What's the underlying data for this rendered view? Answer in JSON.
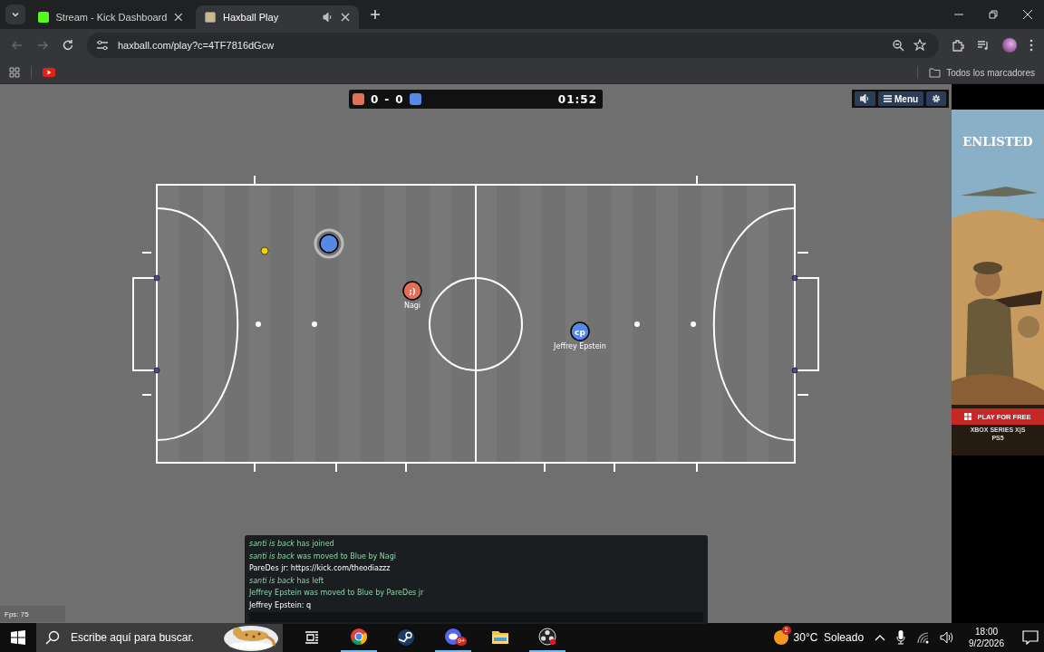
{
  "browser": {
    "tabs": [
      {
        "title": "Stream - Kick Dashboard",
        "selected": false,
        "audio": false
      },
      {
        "title": "Haxball Play",
        "selected": true,
        "audio": true
      }
    ],
    "url": "haxball.com/play?c=4TF7816dGcw",
    "bookmarks_label": "Todos los marcadores"
  },
  "game": {
    "score": {
      "red": "0",
      "separator": "-",
      "blue": "0"
    },
    "time": "01:52",
    "players": [
      {
        "color": "#5689e5",
        "self": true
      },
      {
        "color": "#e56e56",
        "avatar": ";)",
        "name": "Nagi",
        "self": false
      },
      {
        "color": "#5689e5",
        "avatar": "cp",
        "name": "Jeffrey Epstein",
        "self": false
      }
    ],
    "menu_label": "Menu",
    "chat": [
      {
        "kind": "system",
        "text": "*santi is back* has joined"
      },
      {
        "kind": "system",
        "text": "*santi is back* was moved to Blue by Nagi"
      },
      {
        "kind": "message",
        "text": "PareDes jr: https://kick.com/theodiazzz"
      },
      {
        "kind": "system",
        "text": "*santi is back* has left"
      },
      {
        "kind": "system",
        "text": "Jeffrey Epstein was moved to Blue by PareDes jr"
      },
      {
        "kind": "message",
        "text": "Jeffrey Epstein: q"
      }
    ],
    "fps": "Fps: 75"
  },
  "ad": {
    "logo": "ENLISTED",
    "cta": "PLAY FOR FREE",
    "platforms": [
      "XBOX SERIES X|S",
      "PS5"
    ]
  },
  "taskbar": {
    "search_placeholder": "Escribe aquí para buscar.",
    "badge": "9+",
    "weather_badge": "2",
    "weather": "30°C  Soleado",
    "time": "18:00",
    "date": "9/2/2026"
  }
}
